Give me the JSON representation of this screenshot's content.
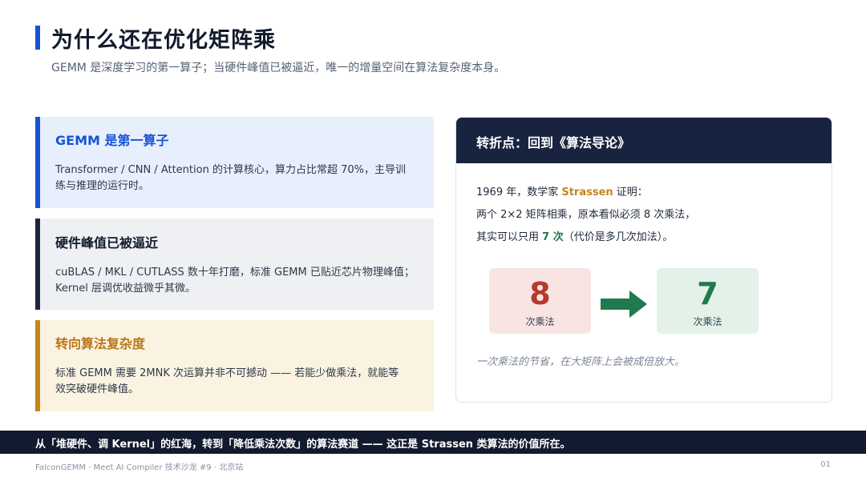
{
  "header": {
    "title": "为什么还在优化矩阵乘",
    "subtitle": "GEMM 是深度学习的第一算子；当硬件峰值已被逼近，唯一的增量空间在算法复杂度本身。"
  },
  "cards": [
    {
      "title": "GEMM 是第一算子",
      "body_line1": "Transformer / CNN / Attention 的计算核心，算力占比常超 70%，主导训",
      "body_line2": "练与推理的运行时。",
      "accent": "#1554d6"
    },
    {
      "title": "硬件峰值已被逼近",
      "body_line1": "cuBLAS / MKL / CUTLASS 数十年打磨，标准 GEMM 已贴近芯片物理峰值；",
      "body_line2": "Kernel 层调优收益微乎其微。",
      "accent": "#1b2740"
    },
    {
      "title": "转向算法复杂度",
      "body_line1": "标准 GEMM 需要 2MNK 次运算并非不可撼动 —— 若能少做乘法，就能等",
      "body_line2": "效突破硬件峰值。",
      "accent": "#c5841f"
    }
  ],
  "panel": {
    "title": "转折点：回到《算法导论》",
    "line1_pre": "1969 年，数学家 ",
    "line1_hl": "Strassen",
    "line1_post": " 证明：",
    "line2": "两个 2×2 矩阵相乘，原本看似必须 8 次乘法，",
    "line3_pre": "其实可以只用 ",
    "line3_hl": "7 次",
    "line3_post": "（代价是多几次加法）。",
    "before_value": "8",
    "before_label": "次乘法",
    "after_value": "7",
    "after_label": "次乘法",
    "note": "一次乘法的节省，在大矩阵上会被成倍放大。"
  },
  "banner": "从「堆硬件、调 Kernel」的红海，转到「降低乘法次数」的算法赛道 —— 这正是 Strassen 类算法的价值所在。",
  "footer": {
    "left": "FalconGEMM · Meet AI Compiler 技术沙龙 #9 · 北京站",
    "page": "01"
  }
}
